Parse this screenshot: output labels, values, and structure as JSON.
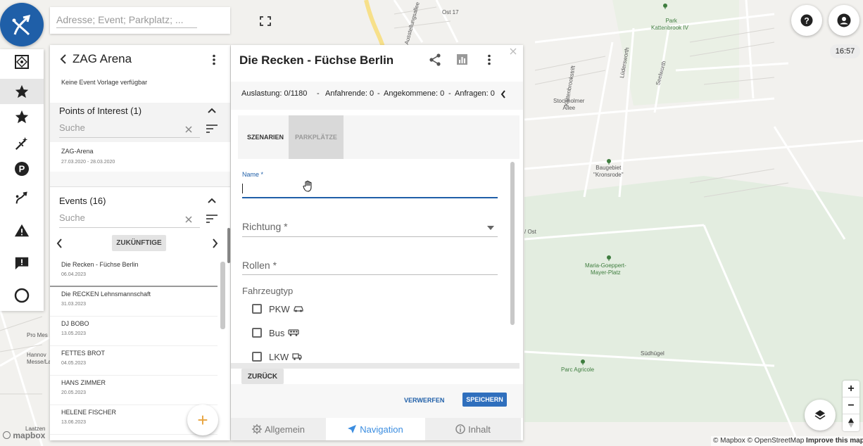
{
  "search": {
    "placeholder": "Adresse; Event; Parkplatz; ..."
  },
  "left_panel": {
    "title": "ZAG Arena",
    "no_template": "Keine Event Vorlage verfügbar",
    "poi": {
      "title": "Points of Interest (1)",
      "search_placeholder": "Suche",
      "items": [
        {
          "name": "ZAG-Arena",
          "date": "27.03.2020 - 28.03.2020"
        }
      ]
    },
    "events": {
      "title": "Events (16)",
      "search_placeholder": "Suche",
      "filter_label": "ZUKÜNFTIGE",
      "items": [
        {
          "name": "Die Recken - Füchse Berlin",
          "date": "06.04.2023"
        },
        {
          "name": "Die RECKEN Lehnsmannschaft",
          "date": "31.03.2023"
        },
        {
          "name": "DJ BOBO",
          "date": "13.05.2023"
        },
        {
          "name": "FETTES BROT",
          "date": "04.05.2023"
        },
        {
          "name": "HANS ZIMMER",
          "date": "20.05.2023"
        },
        {
          "name": "HELENE FISCHER",
          "date": "13.06.2023"
        }
      ]
    },
    "fab_label": "+"
  },
  "detail": {
    "title": "Die Recken - Füchse Berlin",
    "stats": {
      "auslastung": "Auslastung: 0/1180",
      "sep1": "-",
      "anfahrende": "Anfahrende: 0",
      "sep2": "-",
      "angekommene": "Angekommene: 0",
      "sep3": "-",
      "anfragen": "Anfragen: 0"
    },
    "tabs": {
      "szenarien": "SZENARIEN",
      "parkplaetze": "PARKPLÄTZE"
    },
    "form": {
      "name_label": "Name *",
      "name_value": "",
      "richtung_label": "Richtung *",
      "rollen_label": "Rollen *",
      "fahrzeugtyp_label": "Fahrzeugtyp",
      "vehicles": [
        {
          "label": "PKW",
          "icon": "car-icon"
        },
        {
          "label": "Bus",
          "icon": "bus-icon"
        },
        {
          "label": "LKW",
          "icon": "truck-icon"
        }
      ]
    },
    "back_label": "ZURÜCK",
    "discard_label": "VERWERFEN",
    "save_label": "SPEICHERN",
    "bottom_tabs": {
      "allgemein": "Allgemein",
      "navigation": "Navigation",
      "inhalt": "Inhalt"
    }
  },
  "clock": "16:57",
  "attribution": {
    "mapbox": "© Mapbox",
    "osm": "© OpenStreetMap",
    "improve": "Improve this map"
  },
  "mapbox_logo": "mapbox",
  "map_labels": {
    "ost17": "Ost 17",
    "park": "Park\nKattenbrook IV",
    "stockholmer": "Stockholmer\nAllee",
    "baugebiet": "Baugebiet\n\"Kronsrode\"",
    "maria": "Maria-Goeppert-\nMayer-Platz",
    "suedhuegel": "Südhügel",
    "parc": "Parc Agricole",
    "kattenbrook": "Kattenbrookstrift",
    "luedersworth": "Lüdersworth",
    "seelworth": "Seelworth",
    "ausstellung": "Ausstellungsallee",
    "pro_mes": "Pro Mes",
    "hannov": "Hannov\nMesse/La",
    "laatzen": "Laatzen",
    "ost": "/ Ost"
  },
  "colors": {
    "accent": "#1f5fa8",
    "park_green": "#3f7d3f",
    "road_yellow": "#f7e08a"
  }
}
